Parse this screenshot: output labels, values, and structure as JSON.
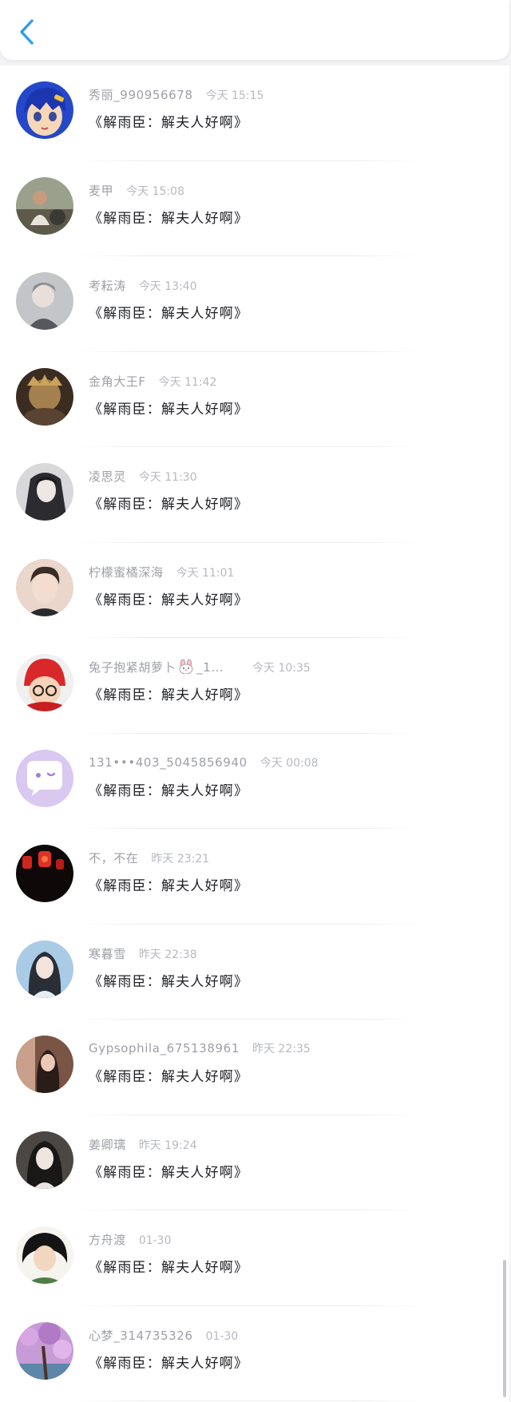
{
  "header": {
    "back_icon": "chevron-left-icon",
    "accent": "#2f9ee8"
  },
  "rows": [
    {
      "name": "秀丽_990956678",
      "time": "今天 15:15",
      "message": "《解雨臣：解夫人好啊》",
      "avatar_color": "#2547c9"
    },
    {
      "name": "麦甲",
      "time": "今天 15:08",
      "message": "《解雨臣：解夫人好啊》",
      "avatar_color": "#6b6a55"
    },
    {
      "name": "考耘涛",
      "time": "今天 13:40",
      "message": "《解雨臣：解夫人好啊》",
      "avatar_color": "#a7a9ae"
    },
    {
      "name": "金角大王F",
      "time": "今天 11:42",
      "message": "《解雨臣：解夫人好啊》",
      "avatar_color": "#6f5a3a"
    },
    {
      "name": "凌思灵",
      "time": "今天 11:30",
      "message": "《解雨臣：解夫人好啊》",
      "avatar_color": "#6e6e70"
    },
    {
      "name": "柠檬蜜橘深海",
      "time": "今天 11:01",
      "message": "《解雨臣：解夫人好啊》",
      "avatar_color": "#d9c2b4"
    },
    {
      "name": "兔子抱紧胡萝卜",
      "name_suffix": "_1…",
      "time": "今天 10:35",
      "message": "《解雨臣：解夫人好啊》",
      "avatar_color": "#d8282a"
    },
    {
      "name": "131•••403_5045856940",
      "time": "今天 00:08",
      "message": "《解雨臣：解夫人好啊》",
      "avatar_color": "#d9c8ef"
    },
    {
      "name": "不，不在",
      "time": "昨天 23:21",
      "message": "《解雨臣：解夫人好啊》",
      "avatar_color": "#1a0e0e"
    },
    {
      "name": "寒暮雪",
      "time": "昨天 22:38",
      "message": "《解雨臣：解夫人好啊》",
      "avatar_color": "#8fb7d9"
    },
    {
      "name": "Gypsophila_675138961",
      "time": "昨天 22:35",
      "message": "《解雨臣：解夫人好啊》",
      "avatar_color": "#8a6a5c"
    },
    {
      "name": "姜卿璃",
      "time": "昨天 19:24",
      "message": "《解雨臣：解夫人好啊》",
      "avatar_color": "#5b5854"
    },
    {
      "name": "方舟渡",
      "time": "01-30",
      "message": "《解雨臣：解夫人好啊》",
      "avatar_color": "#4f7d45"
    },
    {
      "name": "心梦_314735326",
      "time": "01-30",
      "message": "《解雨臣：解夫人好啊》",
      "avatar_color": "#b07ac7"
    }
  ]
}
